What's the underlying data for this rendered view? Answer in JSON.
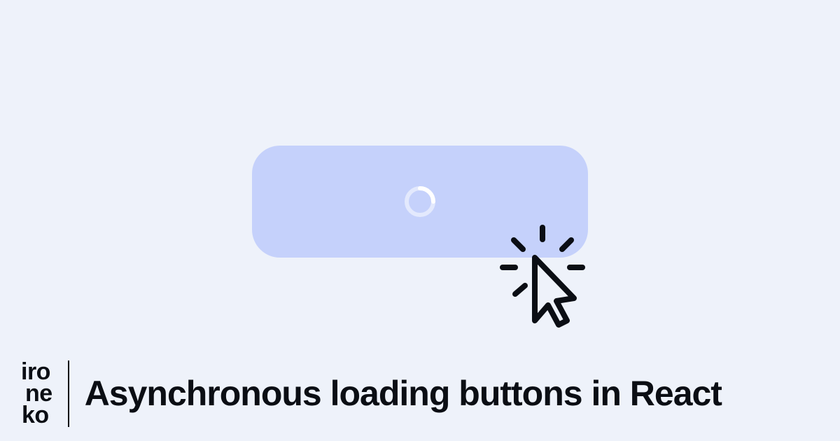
{
  "logo": {
    "line1": "iro",
    "line2": "ne",
    "line3": "ko"
  },
  "title": "Asynchronous loading buttons in React",
  "colors": {
    "background": "#EEF2FA",
    "button": "#C5D1FB",
    "text": "#0B0E14"
  }
}
